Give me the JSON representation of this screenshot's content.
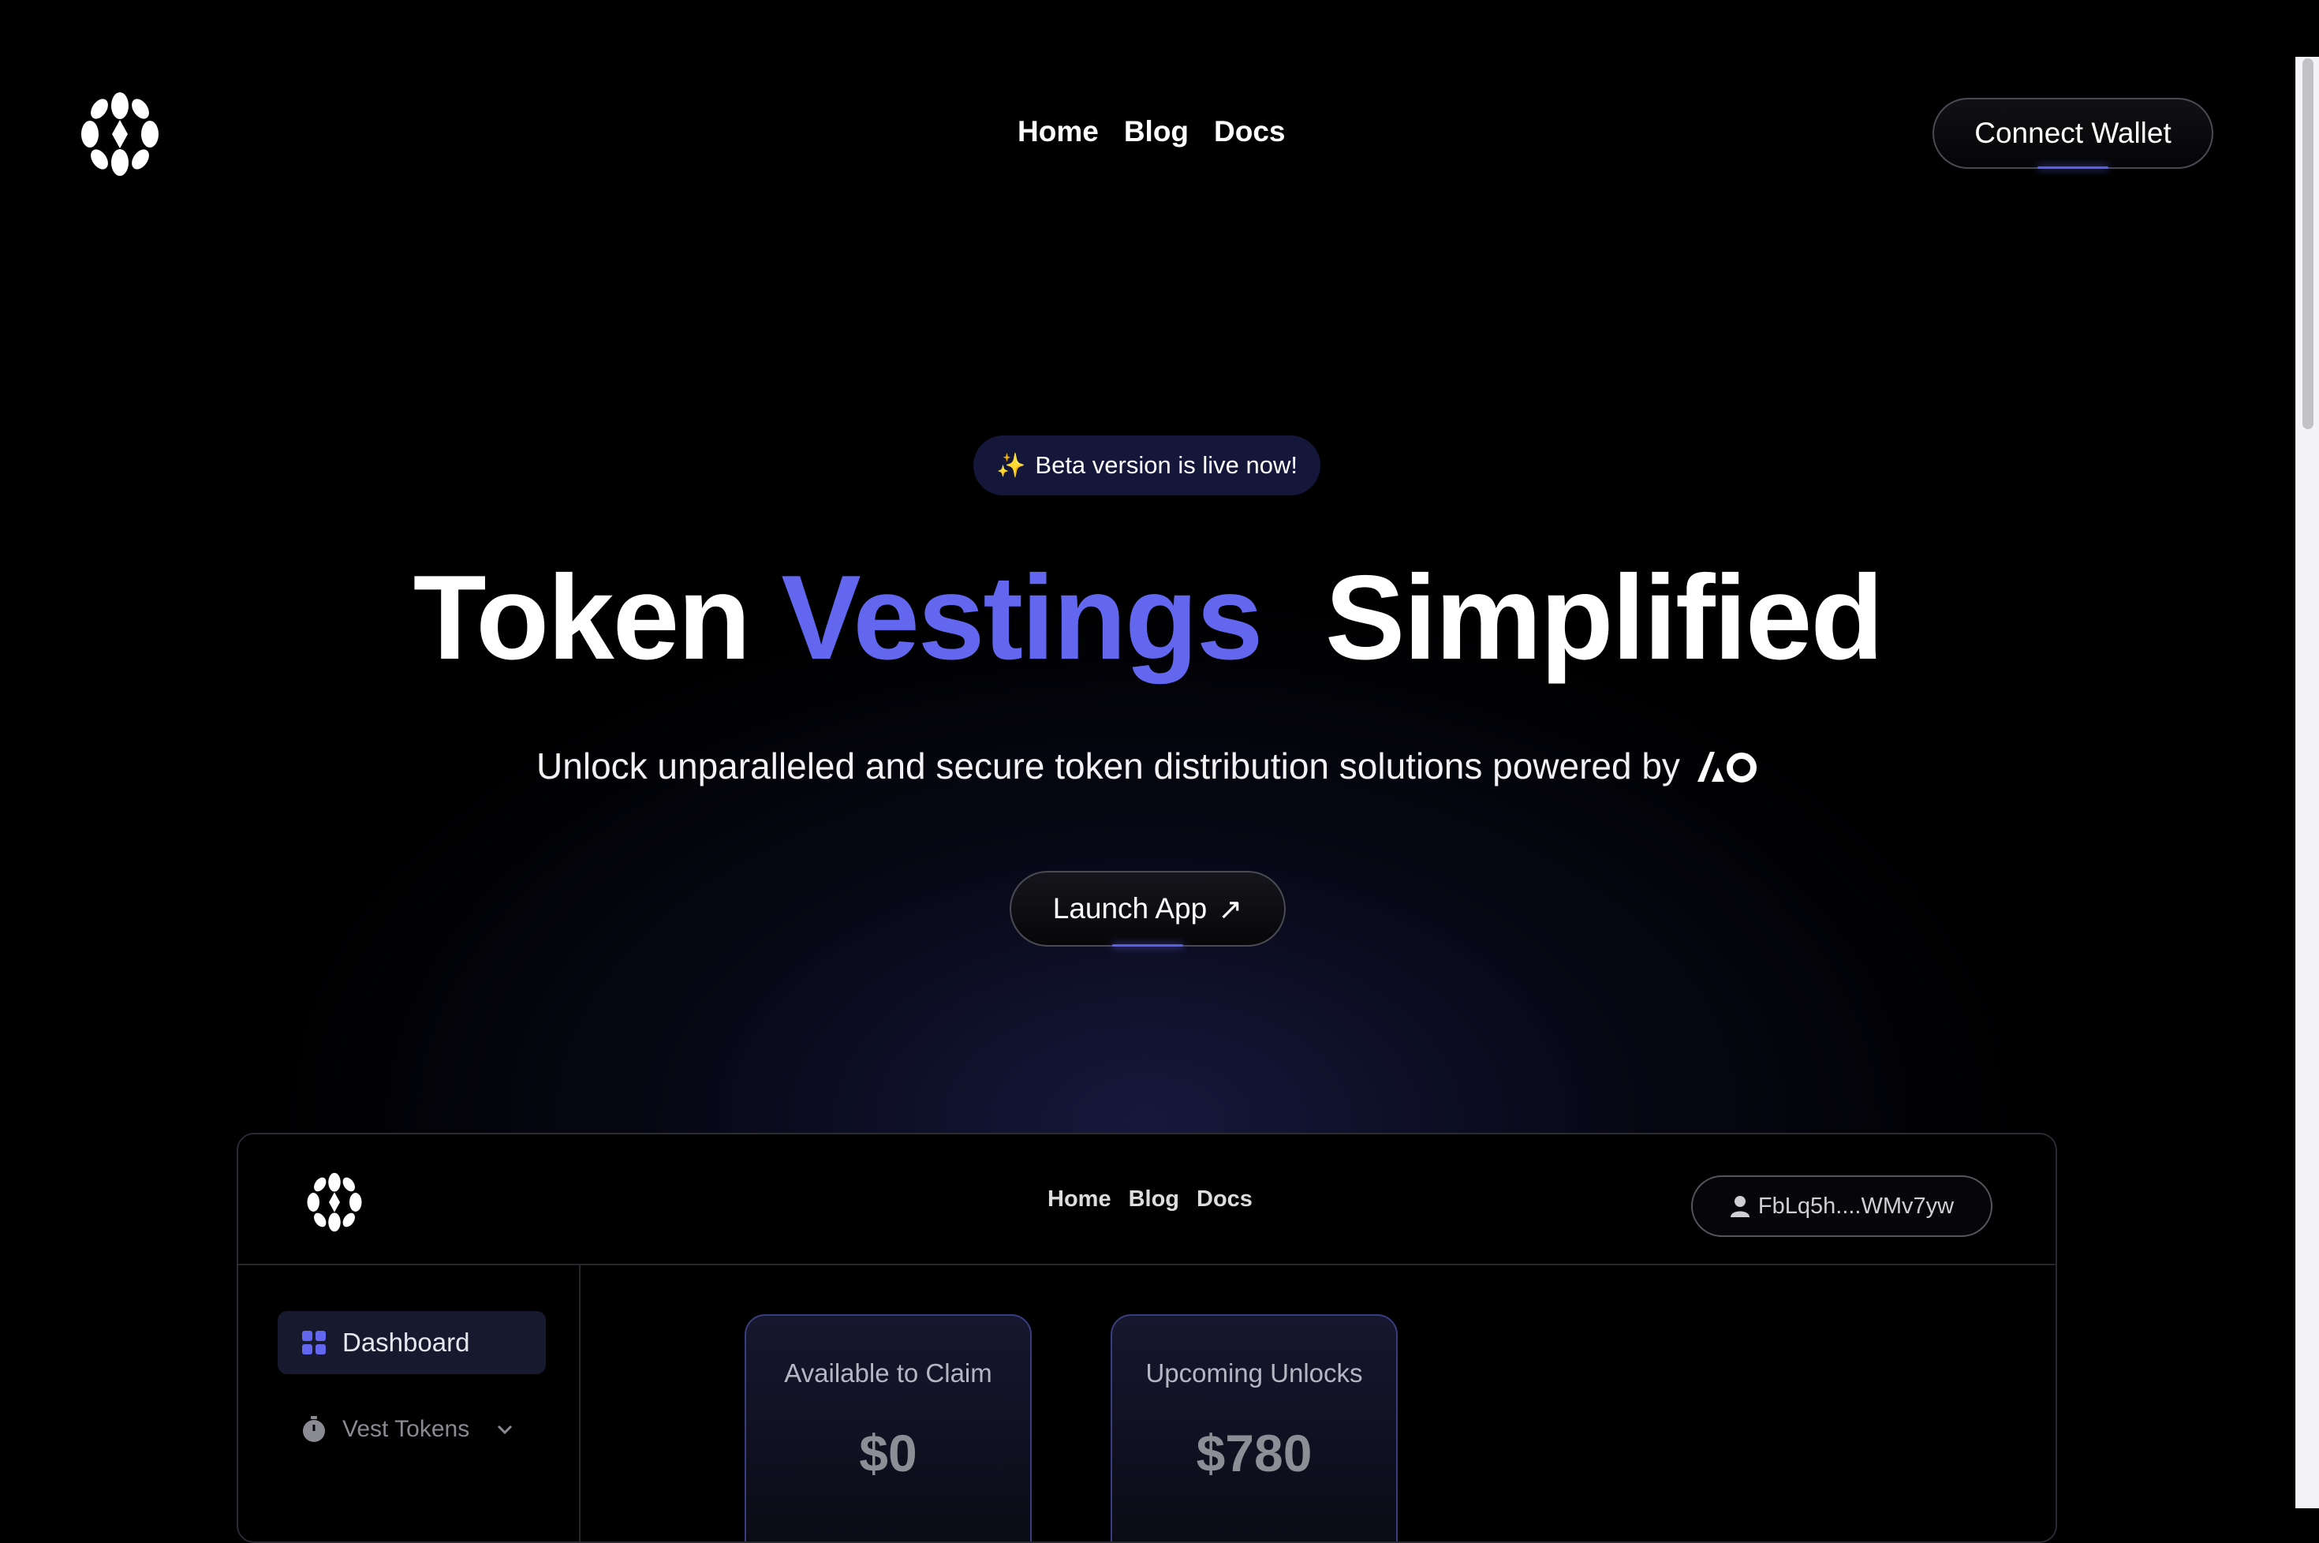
{
  "nav": {
    "links": [
      "Home",
      "Blog",
      "Docs"
    ],
    "connect_label": "Connect Wallet"
  },
  "hero": {
    "badge_icon": "✨",
    "badge_text": "Beta version is live now!",
    "title_part1": "Token",
    "title_accent": "Vestings",
    "title_part2": "Simplified",
    "subtitle": "Unlock unparalleled and secure token distribution solutions powered by",
    "launch_label": "Launch App",
    "launch_icon": "↗"
  },
  "preview": {
    "nav": [
      "Home",
      "Blog",
      "Docs"
    ],
    "wallet": "FbLq5h....WMv7yw",
    "sidebar": [
      {
        "label": "Dashboard",
        "icon": "grid-icon"
      },
      {
        "label": "Vest Tokens",
        "icon": "stopwatch-icon"
      }
    ],
    "cards": [
      {
        "label": "Available to Claim",
        "value": "$0"
      },
      {
        "label": "Upcoming Unlocks",
        "value": "$780"
      }
    ]
  },
  "colors": {
    "accent": "#6367f0",
    "background": "#000000",
    "badge_bg": "#14173a"
  }
}
